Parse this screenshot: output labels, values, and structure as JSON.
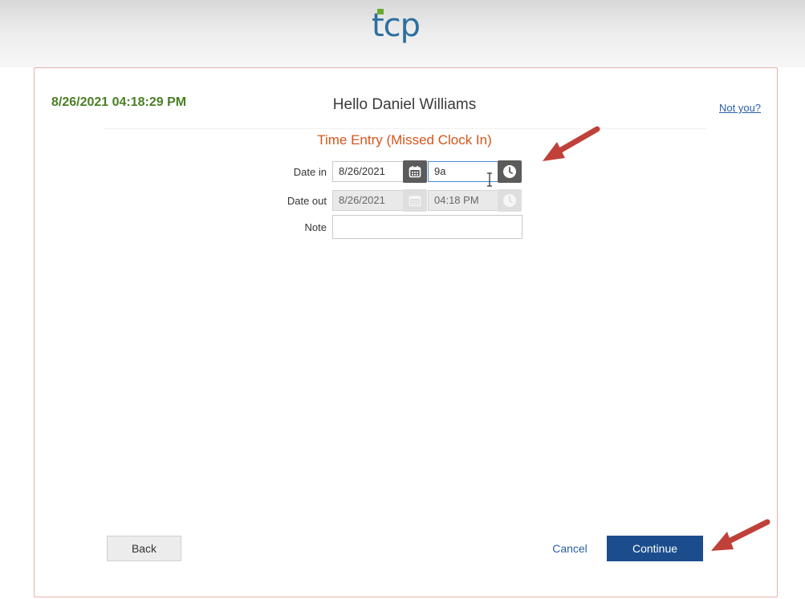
{
  "header": {
    "logo_text": "tcp",
    "logo_accent_color": "#6aaa2e",
    "logo_color": "#2d6f9f"
  },
  "panel": {
    "datetime": "8/26/2021 04:18:29 PM",
    "greeting": "Hello Daniel Williams",
    "not_you": "Not you?",
    "section_title": "Time Entry (Missed Clock In)"
  },
  "form": {
    "date_in": {
      "label": "Date in",
      "date_value": "8/26/2021",
      "time_value": "9a"
    },
    "date_out": {
      "label": "Date out",
      "date_value": "8/26/2021",
      "time_value": "04:18 PM"
    },
    "note": {
      "label": "Note",
      "value": ""
    }
  },
  "footer": {
    "back_label": "Back",
    "cancel_label": "Cancel",
    "continue_label": "Continue"
  },
  "colors": {
    "accent_orange": "#d4541a",
    "brand_blue": "#1b4d8d",
    "datetime_green": "#4a7f24",
    "annotation_arrow": "#c0403a"
  }
}
